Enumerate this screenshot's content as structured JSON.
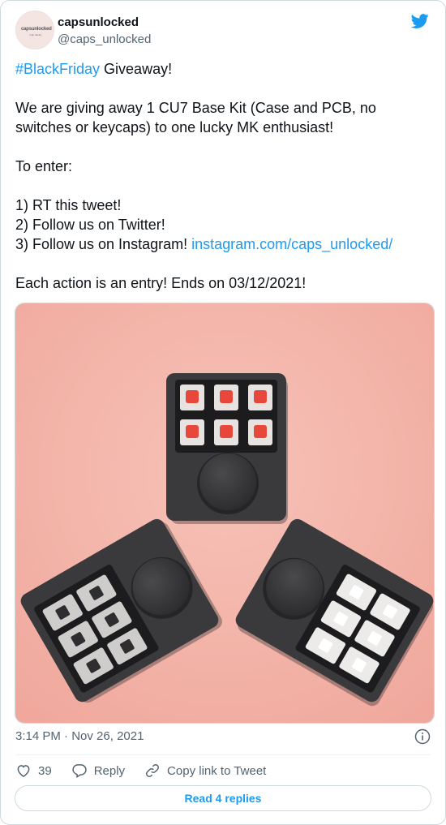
{
  "author": {
    "name": "capsunlocked",
    "handle": "@caps_unlocked",
    "avatar_text": "capsunlocked",
    "avatar_subtext": "high fidelity"
  },
  "tweet": {
    "hashtag": "#BlackFriday",
    "line1_rest": " Giveaway!",
    "paragraph2": "We are giving away 1 CU7 Base Kit (Case and PCB, no switches or keycaps) to one lucky MK enthusiast!",
    "to_enter": "To enter:",
    "step1": "1) RT this tweet!",
    "step2": "2) Follow us on Twitter!",
    "step3_text": "3) Follow us on Instagram! ",
    "step3_link": "instagram.com/caps_unlocked/",
    "closing": "Each action is an entry! Ends on 03/12/2021!"
  },
  "meta": {
    "time": "3:14 PM",
    "separator": " · ",
    "date": "Nov 26, 2021"
  },
  "actions": {
    "like_count": "39",
    "reply_label": "Reply",
    "copy_label": "Copy link to Tweet"
  },
  "read_replies_label": "Read 4 replies",
  "colors": {
    "link": "#1d9bf0",
    "photo_background": "#f5b5aa",
    "macropad_case": "#3a3a3c"
  },
  "icons": [
    "twitter-bird-icon",
    "info-icon",
    "heart-icon",
    "reply-icon",
    "link-icon"
  ]
}
